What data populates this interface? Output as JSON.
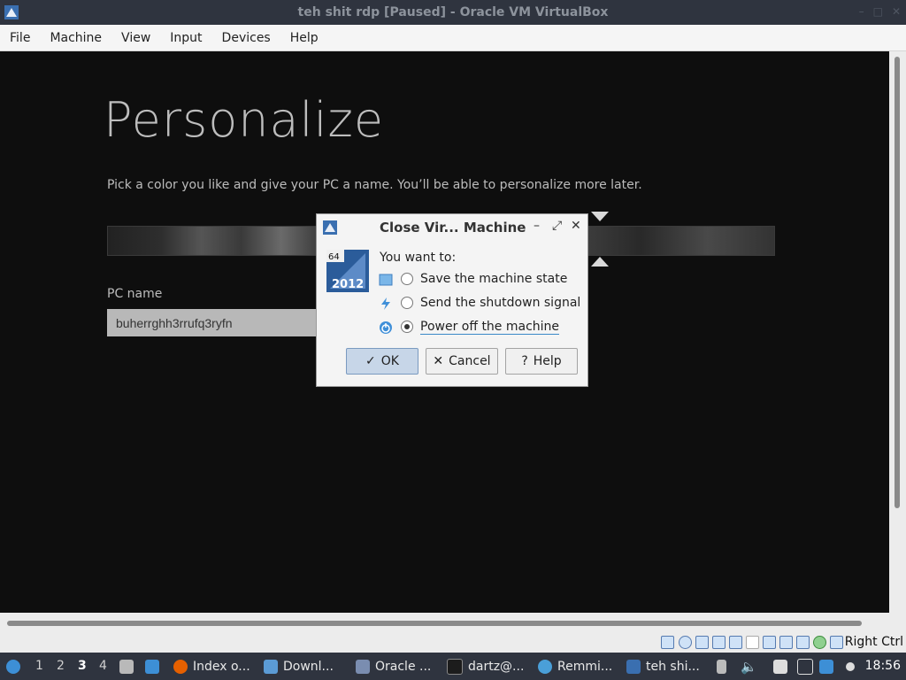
{
  "window": {
    "title": "teh shit rdp [Paused] - Oracle VM VirtualBox"
  },
  "menubar": {
    "items": [
      "File",
      "Machine",
      "View",
      "Input",
      "Devices",
      "Help"
    ]
  },
  "vm_screen": {
    "heading": "Personalize",
    "subtitle": "Pick a color you like and give your PC a name. You’ll be able to personalize more later.",
    "pc_name_label": "PC name",
    "pc_name_value": "buherrghh3rrufq3ryfn"
  },
  "dialog": {
    "title": "Close Vir... Machine",
    "prompt": "You want to:",
    "icon_badge_top": "64",
    "icon_badge_bottom": "2012",
    "options": [
      {
        "label": "Save the machine state",
        "selected": false
      },
      {
        "label": "Send the shutdown signal",
        "selected": false
      },
      {
        "label": "Power off the machine",
        "selected": true
      }
    ],
    "buttons": {
      "ok": "OK",
      "cancel": "Cancel",
      "help": "Help"
    }
  },
  "statusbar": {
    "host_key": "Right Ctrl"
  },
  "taskbar": {
    "workspaces": [
      "1",
      "2",
      "3",
      "4"
    ],
    "active_workspace": "3",
    "tasks": [
      {
        "label": "Index o...",
        "icon": "firefox-icon"
      },
      {
        "label": "Downl...",
        "icon": "folder-icon"
      },
      {
        "label": "Oracle ...",
        "icon": "virtualbox-icon"
      },
      {
        "label": "dartz@...",
        "icon": "terminal-icon"
      },
      {
        "label": "Remmi...",
        "icon": "remmina-icon"
      },
      {
        "label": "teh shi...",
        "icon": "vm-window-icon"
      }
    ],
    "clock": "18:56"
  },
  "colors": {
    "titlebar_bg": "#2f343f",
    "taskbar_bg": "#2f343f",
    "vm_bg": "#0e0e0e",
    "dialog_bg": "#f4f4f4",
    "accent": "#3a88c8"
  }
}
